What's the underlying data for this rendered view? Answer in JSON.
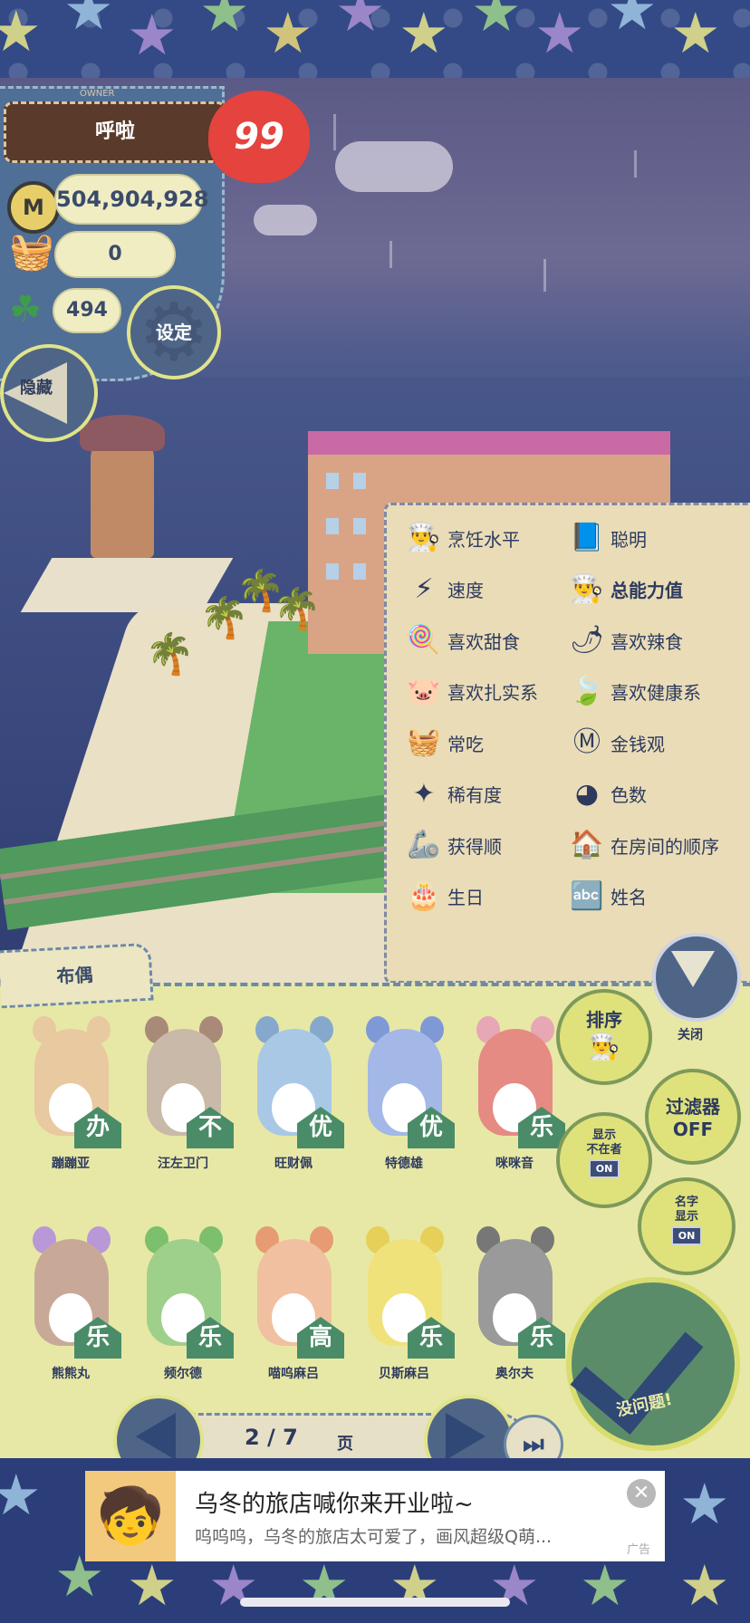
{
  "hud": {
    "owner_tag": "OWNER",
    "owner_name": "呼啦",
    "hearts": "99",
    "coin_symbol": "M",
    "money": "504,904,928",
    "food_count": "0",
    "clover_count": "494",
    "settings_label": "设定",
    "hide_label": "隐藏"
  },
  "sort_options": [
    {
      "icon": "chef-hat-icon",
      "glyph": "👨‍🍳",
      "label": "烹饪水平"
    },
    {
      "icon": "book-icon",
      "glyph": "📘",
      "label": "聪明"
    },
    {
      "icon": "speed-icon",
      "glyph": "⚡",
      "label": "速度"
    },
    {
      "icon": "total-ability-icon",
      "glyph": "👨‍🍳",
      "label": "总能力值",
      "bold": true
    },
    {
      "icon": "lollipop-icon",
      "glyph": "🍭",
      "label": "喜欢甜食"
    },
    {
      "icon": "chili-icon",
      "glyph": "🌶",
      "label": "喜欢辣食"
    },
    {
      "icon": "pig-icon",
      "glyph": "🐷",
      "label": "喜欢扎实系"
    },
    {
      "icon": "leaf-icon",
      "glyph": "🍃",
      "label": "喜欢健康系"
    },
    {
      "icon": "basket-icon",
      "glyph": "🧺",
      "label": "常吃"
    },
    {
      "icon": "money-icon",
      "glyph": "Ⓜ",
      "label": "金钱观"
    },
    {
      "icon": "sparkle-icon",
      "glyph": "✦",
      "label": "稀有度"
    },
    {
      "icon": "color-wheel-icon",
      "glyph": "◕",
      "label": "色数"
    },
    {
      "icon": "claw-icon",
      "glyph": "🦾",
      "label": "获得顺"
    },
    {
      "icon": "house-icon",
      "glyph": "🏠",
      "label": "在房间的顺序"
    },
    {
      "icon": "cake-icon",
      "glyph": "🎂",
      "label": "生日"
    },
    {
      "icon": "abc-icon",
      "glyph": "🔤",
      "label": "姓名"
    }
  ],
  "doll_tab": "布偶",
  "dolls": [
    {
      "name": "蹦蹦亚",
      "badge": "办",
      "color": "#e8c9a0",
      "ear": "#e8c9a0"
    },
    {
      "name": "汪左卫门",
      "badge": "不",
      "color": "#c9b9a8",
      "ear": "#a98a78"
    },
    {
      "name": "旺财佩",
      "badge": "优",
      "color": "#a9c8e6",
      "ear": "#86a8cc"
    },
    {
      "name": "特德雄",
      "badge": "优",
      "color": "#a3b8e6",
      "ear": "#7f99d6"
    },
    {
      "name": "咪咪音",
      "badge": "乐",
      "color": "#e68a84",
      "ear": "#e8a7b4"
    },
    {
      "name": "熊熊丸",
      "badge": "乐",
      "color": "#c8a997",
      "ear": "#b998d8"
    },
    {
      "name": "频尔德",
      "badge": "乐",
      "color": "#9ed08c",
      "ear": "#7cbf6c"
    },
    {
      "name": "喵呜麻吕",
      "badge": "高",
      "color": "#f0c0a0",
      "ear": "#e69b72"
    },
    {
      "name": "贝斯麻吕",
      "badge": "乐",
      "color": "#f0e27a",
      "ear": "#e6d05a"
    },
    {
      "name": "奥尔夫",
      "badge": "乐",
      "color": "#9a9a9a",
      "ear": "#777777"
    }
  ],
  "side_buttons": {
    "sort_label": "排序",
    "filter_label": "过滤器",
    "filter_state": "OFF",
    "show_absent_label": "显示\n不在者",
    "show_absent_state": "ON",
    "show_name_label": "名字\n显示",
    "show_name_state": "ON",
    "close_label": "关闭",
    "ok_label": "没问题!"
  },
  "pager": {
    "page": "2 / 7",
    "unit": "页"
  },
  "ad": {
    "title": "乌冬的旅店喊你来开业啦~",
    "desc": "呜呜呜，乌冬的旅店太可爱了，画风超级Q萌...",
    "tag": "广告"
  }
}
